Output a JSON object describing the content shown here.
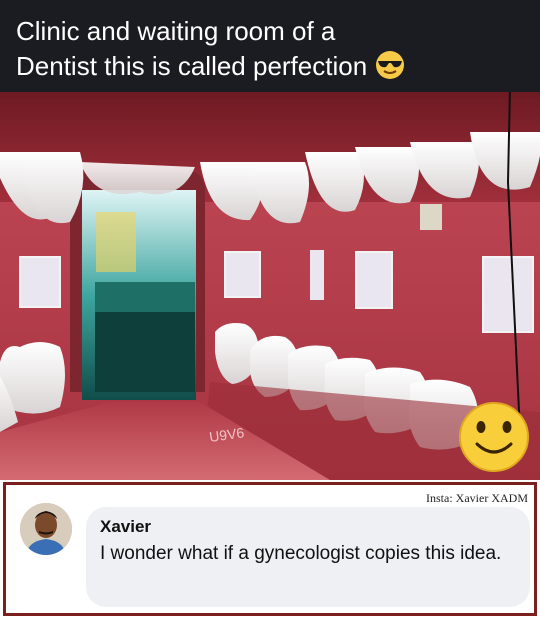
{
  "caption": {
    "line1": "Clinic and waiting room of a",
    "line2": "Dentist this is called perfection",
    "emoji": "smiling-face-with-sunglasses"
  },
  "photo": {
    "subject": "tooth-shaped-seating",
    "overlay_emoji": "slightly-smiling-face",
    "floor_text": "U9V6"
  },
  "comment": {
    "credit": "Insta: Xavier XADM",
    "author": "Xavier",
    "text": "I wonder what if a gynecologist copies this idea."
  }
}
